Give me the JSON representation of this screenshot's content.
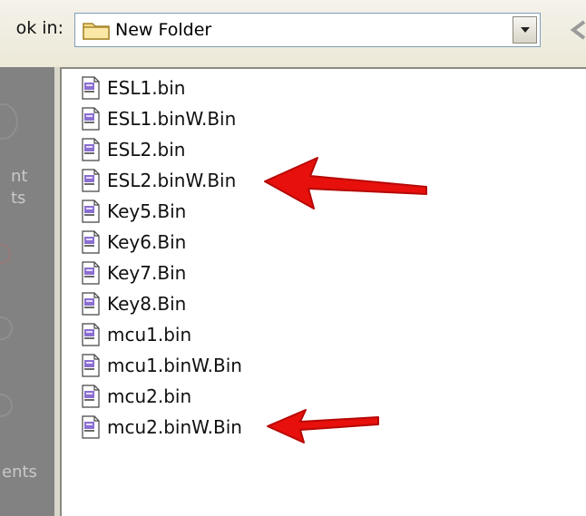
{
  "dialog": {
    "look_in_label": "ok in:",
    "look_in_value": "New Folder"
  },
  "places_bar": {
    "fragments": [
      "nt",
      "ts",
      "ents"
    ]
  },
  "files": [
    {
      "name": "ESL1.bin"
    },
    {
      "name": "ESL1.binW.Bin"
    },
    {
      "name": "ESL2.bin"
    },
    {
      "name": "ESL2.binW.Bin",
      "highlighted": true
    },
    {
      "name": "Key5.Bin"
    },
    {
      "name": "Key6.Bin"
    },
    {
      "name": "Key7.Bin"
    },
    {
      "name": "Key8.Bin"
    },
    {
      "name": "mcu1.bin"
    },
    {
      "name": "mcu1.binW.Bin"
    },
    {
      "name": "mcu2.bin"
    },
    {
      "name": "mcu2.binW.Bin",
      "highlighted": true
    }
  ],
  "annotation": {
    "arrow_color": "#e8100c",
    "icons": [
      "folder-icon",
      "chevron-down-icon",
      "back-icon",
      "bin-file-icon",
      "red-arrow-icon"
    ]
  }
}
